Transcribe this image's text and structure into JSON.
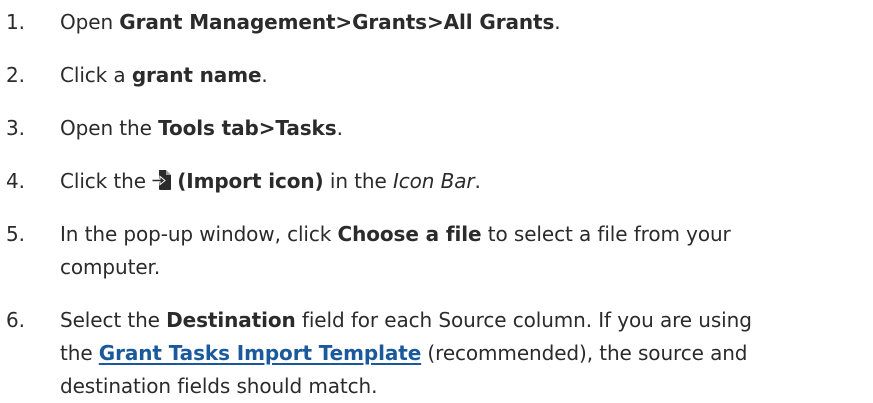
{
  "steps": [
    {
      "number": "1.",
      "pre": "Open ",
      "bold": "Grant Management>Grants>All Grants",
      "post": "."
    },
    {
      "number": "2.",
      "pre": "Click a ",
      "bold": "grant name",
      "post": "."
    },
    {
      "number": "3.",
      "pre": "Open the ",
      "bold": "Tools tab>Tasks",
      "post": "."
    },
    {
      "number": "4.",
      "pre": "Click the ",
      "icon": "import-file-icon",
      "bold": "(Import icon)",
      "mid": " in the ",
      "italic": "Icon Bar",
      "post": "."
    },
    {
      "number": "5.",
      "pre": "In the pop-up window, click ",
      "bold": "Choose a file",
      "post_line1": " to select a file from your",
      "post_line2": "computer."
    },
    {
      "number": "6.",
      "pre": "Select the ",
      "bold": "Destination",
      "post_line1": " field for each Source column. If you are using",
      "line2_pre": "the ",
      "link": "Grant Tasks Import Template",
      "line2_post": " (recommended), the source and",
      "line3": "destination fields should match."
    }
  ],
  "colors": {
    "text": "#2b2b2b",
    "link": "#1a5a9c"
  }
}
